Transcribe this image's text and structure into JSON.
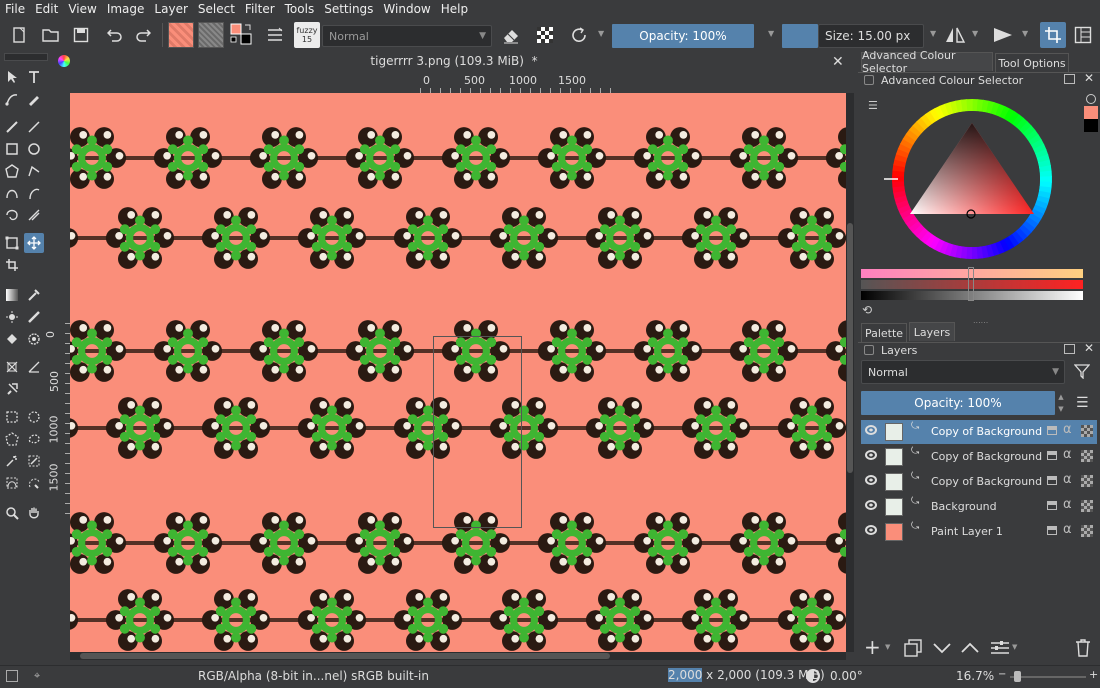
{
  "menu": [
    "File",
    "Edit",
    "View",
    "Image",
    "Layer",
    "Select",
    "Filter",
    "Tools",
    "Settings",
    "Window",
    "Help"
  ],
  "toolbar": {
    "blend_mode": "Normal",
    "opacity_label": "Opacity: 100%",
    "size_label": "Size: 15.00 px",
    "brush_preset_text": "fuzzy 15"
  },
  "document": {
    "tab_title": "tigerrrr 3.png (109.3 MiB)",
    "modified_marker": "*",
    "ruler_h": [
      "0",
      "500",
      "1000",
      "1500"
    ],
    "ruler_v": [
      "0",
      "500",
      "1000",
      "1500"
    ]
  },
  "colors": {
    "accent": "#5582ac",
    "canvas_bg": "#fa8e7a",
    "pattern_green": "#3fb532",
    "foreground": "#fa8e7a",
    "background": "#000000"
  },
  "colour_selector": {
    "tab_label": "Advanced Colour Selector",
    "tab2_label": "Tool Options",
    "panel_title": "Advanced Colour Selector"
  },
  "layers_panel": {
    "tab_palette": "Palette",
    "tab_layers": "Layers",
    "title": "Layers",
    "blend_mode": "Normal",
    "opacity_label": "Opacity:  100%",
    "layers": [
      {
        "name": "Copy of Background",
        "selected": true
      },
      {
        "name": "Copy of Background",
        "selected": false
      },
      {
        "name": "Copy of Background",
        "selected": false
      },
      {
        "name": "Background",
        "selected": false
      },
      {
        "name": "Paint Layer 1",
        "selected": false
      }
    ]
  },
  "status": {
    "color_model": "RGB/Alpha (8-bit in...nel)  sRGB built-in",
    "dims_prefix": "2,000",
    "dims": " x 2,000 (109.3 MiB)",
    "rotation": "0.00°",
    "zoom": "16.7%"
  },
  "icons": [
    "new-document-icon",
    "open-icon",
    "save-icon",
    "undo-icon",
    "redo-icon",
    "eraser-icon",
    "alpha-icon",
    "reload-icon",
    "mirror-icon",
    "wrap-icon",
    "crop-icon",
    "panel-icon"
  ]
}
